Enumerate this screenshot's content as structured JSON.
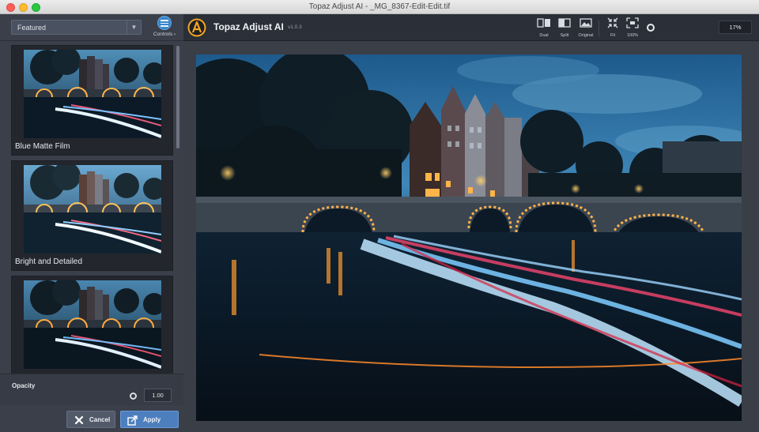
{
  "window": {
    "title": "Topaz Adjust AI - _MG_8367-Edit-Edit.tif"
  },
  "sidebar": {
    "preset_select": {
      "value": "Featured",
      "caret": "▼"
    },
    "controls": {
      "label": "Controls ›",
      "icon": "sliders-icon"
    },
    "presets": [
      {
        "label": "Blue Matte Film"
      },
      {
        "label": "Bright and Detailed"
      },
      {
        "label": ""
      }
    ],
    "opacity": {
      "label": "Opacity",
      "value": "1.00"
    },
    "buttons": {
      "cancel": {
        "label": "Cancel",
        "icon": "close-icon"
      },
      "apply": {
        "label": "Apply",
        "icon": "apply-icon"
      }
    }
  },
  "topbar": {
    "app_name": "Topaz Adjust AI",
    "version": "v1.0.3",
    "tools": [
      {
        "label": "Dual",
        "icon": "dual-view-icon"
      },
      {
        "label": "Split",
        "icon": "split-view-icon"
      },
      {
        "label": "Original",
        "icon": "original-view-icon"
      },
      {
        "label": "Fit",
        "icon": "fit-icon"
      },
      {
        "label": "100%",
        "icon": "actual-size-icon"
      }
    ],
    "zoom": "17%"
  },
  "colors": {
    "accent": "#4d7fbf",
    "panel": "#3a3f4a",
    "topbar": "#2b2f37",
    "logo": "#f5a623"
  }
}
